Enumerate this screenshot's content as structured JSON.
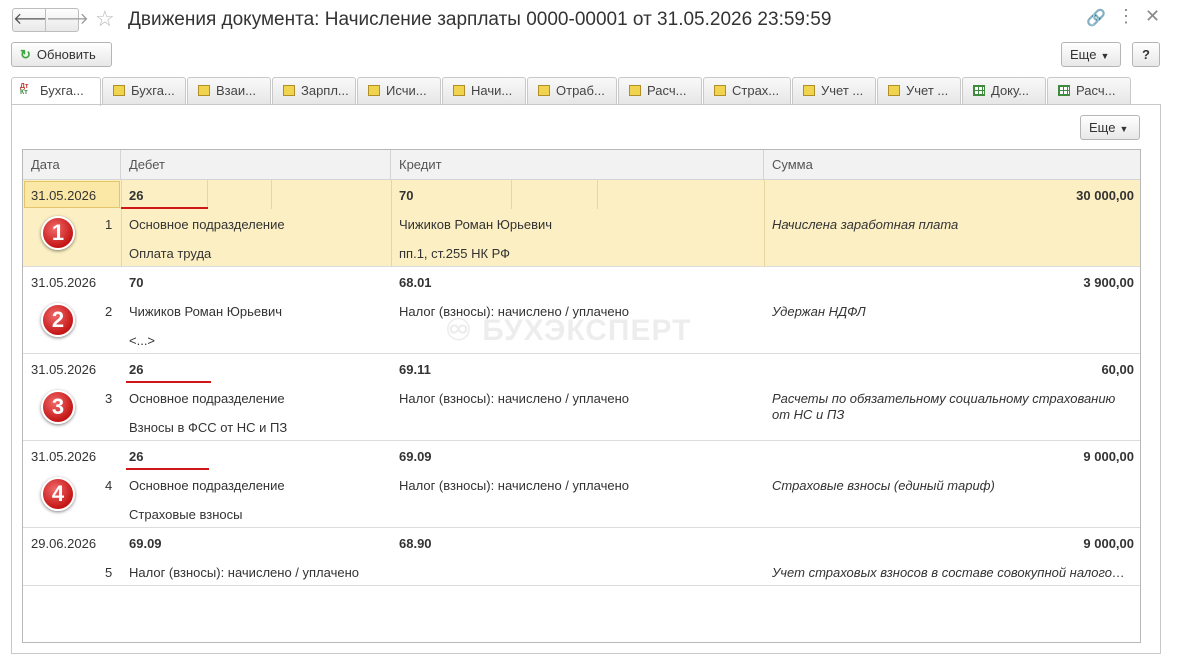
{
  "window": {
    "title": "Движения документа: Начисление зарплаты 0000-00001 от 31.05.2026 23:59:59",
    "back_glyph": "🡐",
    "fwd_glyph": "🡒",
    "star_glyph": "☆",
    "link_glyph": "🔗",
    "menu_glyph": "⋮",
    "close_glyph": "✕"
  },
  "toolbar": {
    "refresh_icon": "↻",
    "refresh_label": "Обновить",
    "more_label": "Еще",
    "help_label": "?",
    "caret": "▼"
  },
  "tabs": [
    {
      "label": "Бухга...",
      "icon": "dt-kt-icon"
    },
    {
      "label": "Бухга...",
      "icon": "register-icon"
    },
    {
      "label": "Взаи...",
      "icon": "register-icon"
    },
    {
      "label": "Зарпл...",
      "icon": "register-icon"
    },
    {
      "label": "Исчи...",
      "icon": "register-icon"
    },
    {
      "label": "Начи...",
      "icon": "register-icon"
    },
    {
      "label": "Отраб...",
      "icon": "register-icon"
    },
    {
      "label": "Расч...",
      "icon": "register-icon"
    },
    {
      "label": "Страх...",
      "icon": "register-icon"
    },
    {
      "label": "Учет ...",
      "icon": "register-icon"
    },
    {
      "label": "Учет ...",
      "icon": "register-icon"
    },
    {
      "label": "Доку...",
      "icon": "table-icon"
    },
    {
      "label": "Расч...",
      "icon": "table-icon"
    }
  ],
  "tab_dtkt": {
    "top": "Дт",
    "bottom": "Кт"
  },
  "table": {
    "more_label": "Еще",
    "columns": [
      "Дата",
      "Дебет",
      "Кредит",
      "Сумма"
    ],
    "rows": [
      {
        "date": "31.05.2026",
        "num": "1",
        "debit": "26",
        "debit_sub1": "Основное подразделение",
        "debit_sub2": "Оплата труда",
        "credit": "70",
        "credit_sub1": "Чижиков Роман Юрьевич",
        "credit_sub2": "пп.1, ст.255 НК РФ",
        "amount": "30 000,00",
        "note": "Начислена заработная плата",
        "badge": "1"
      },
      {
        "date": "31.05.2026",
        "num": "2",
        "debit": "70",
        "debit_sub1": "Чижиков Роман Юрьевич",
        "debit_sub2": "<...>",
        "credit": "68.01",
        "credit_sub1": "Налог (взносы): начислено / уплачено",
        "credit_sub2": "",
        "amount": "3 900,00",
        "note": "Удержан НДФЛ",
        "badge": "2"
      },
      {
        "date": "31.05.2026",
        "num": "3",
        "debit": "26",
        "debit_sub1": "Основное подразделение",
        "debit_sub2": "Взносы в ФСС от НС и ПЗ",
        "credit": "69.11",
        "credit_sub1": "Налог (взносы): начислено / уплачено",
        "credit_sub2": "",
        "amount": "60,00",
        "note": "Расчеты по обязательному социальному страхованию от НС и ПЗ",
        "badge": "3"
      },
      {
        "date": "31.05.2026",
        "num": "4",
        "debit": "26",
        "debit_sub1": "Основное подразделение",
        "debit_sub2": "Страховые взносы",
        "credit": "69.09",
        "credit_sub1": "Налог (взносы): начислено / уплачено",
        "credit_sub2": "",
        "amount": "9 000,00",
        "note": "Страховые взносы (единый тариф)",
        "badge": "4"
      },
      {
        "date": "29.06.2026",
        "num": "5",
        "debit": "69.09",
        "debit_sub1": "Налог (взносы): начислено / уплачено",
        "debit_sub2": "",
        "credit": "68.90",
        "credit_sub1": "",
        "credit_sub2": "",
        "amount": "9 000,00",
        "note": "Учет страховых взносов в составе совокупной налого…",
        "badge": ""
      }
    ]
  },
  "watermark": "♾ БУХЭКСПЕРТ"
}
